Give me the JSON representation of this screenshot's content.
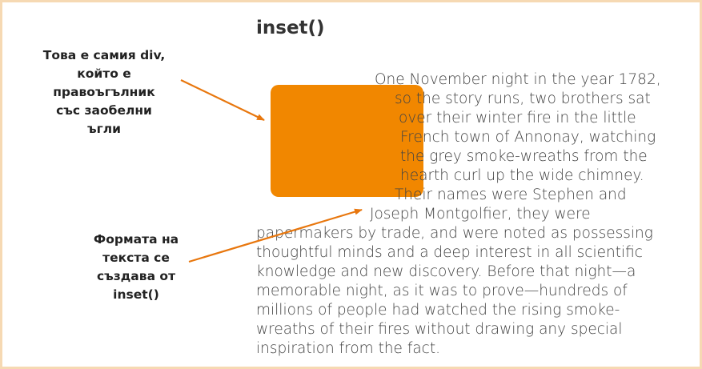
{
  "title": "inset()",
  "callouts": {
    "div_label": [
      "Това е самия div,",
      "който е",
      "правоъгълник",
      "със заобелни",
      "ъгли"
    ],
    "text_label": [
      "Формата на",
      "текста се",
      "създава от",
      "inset()"
    ]
  },
  "paragraph_lines": [
    "One November night in the year 1782,",
    "so the story runs, two brothers sat",
    "over their winter fire in the little",
    "French town of Annonay, watching",
    "the grey smoke-wreaths from the",
    "hearth curl up the wide chimney.",
    "Their names were Stephen and",
    "Joseph Montgolfier, they were",
    "papermakers by trade, and were noted as possessing",
    "thoughtful minds and a deep interest in all scientific",
    "knowledge and new discovery. Before that night—a",
    "memorable night, as it was to prove—hundreds of",
    "millions of people had watched the rising smoke-",
    "wreaths of their fires without drawing any special",
    "inspiration from the fact."
  ],
  "colors": {
    "shape": "#f18700",
    "arrow": "#e8770e",
    "frame_border": "#f6d9b3"
  }
}
